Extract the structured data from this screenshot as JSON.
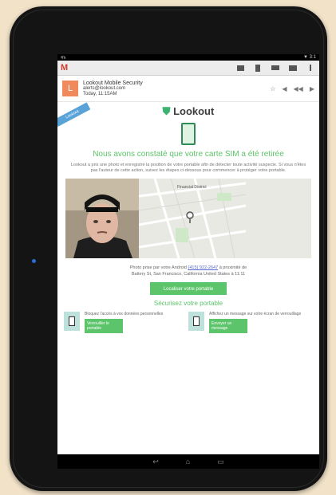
{
  "status": {
    "left": "ৰ৳",
    "right": "▼ 3:1"
  },
  "actionbar": {
    "app_logo": "M",
    "icons": [
      "archive-icon",
      "delete-icon",
      "label-icon",
      "folder-icon",
      "more-icon"
    ]
  },
  "email": {
    "sender_initial": "L",
    "sender_name": "Lookout Mobile Security",
    "sender_email": "alerts@lookout.com",
    "sender_date": "Today, 11:15AM"
  },
  "content": {
    "ribbon": "Lookout",
    "brand": "Lookout",
    "headline": "Nous avons constaté que votre carte SIM a été retirée",
    "paragraph": "Lookout a pris une photo et enregistré la position de votre portable afin de détecter toute activité suspecte. Si vous n'êtes pas l'auteur de cette action, suivez les étapes ci-dessous pour commencer à protéger votre portable.",
    "map_label": "Financial District",
    "caption_prefix": "Photo prise par votre Android",
    "caption_link": "(415) 922-2647",
    "caption_mid": "à proximité de",
    "caption_address": "Battery St, San Francisco, California United States à 11:11",
    "locate_button": "Localiser votre portable",
    "section_title": "Sécurisez votre portable",
    "actions": [
      {
        "text": "Bloquez l'accès à vos données personnelles",
        "button": "Verrouiller le portable"
      },
      {
        "text": "Affichez un message sur votre écran de verrouillage",
        "button": "Envoyer un message"
      }
    ]
  },
  "nav": {
    "back": "↩",
    "home": "⌂",
    "recent": "▭"
  }
}
